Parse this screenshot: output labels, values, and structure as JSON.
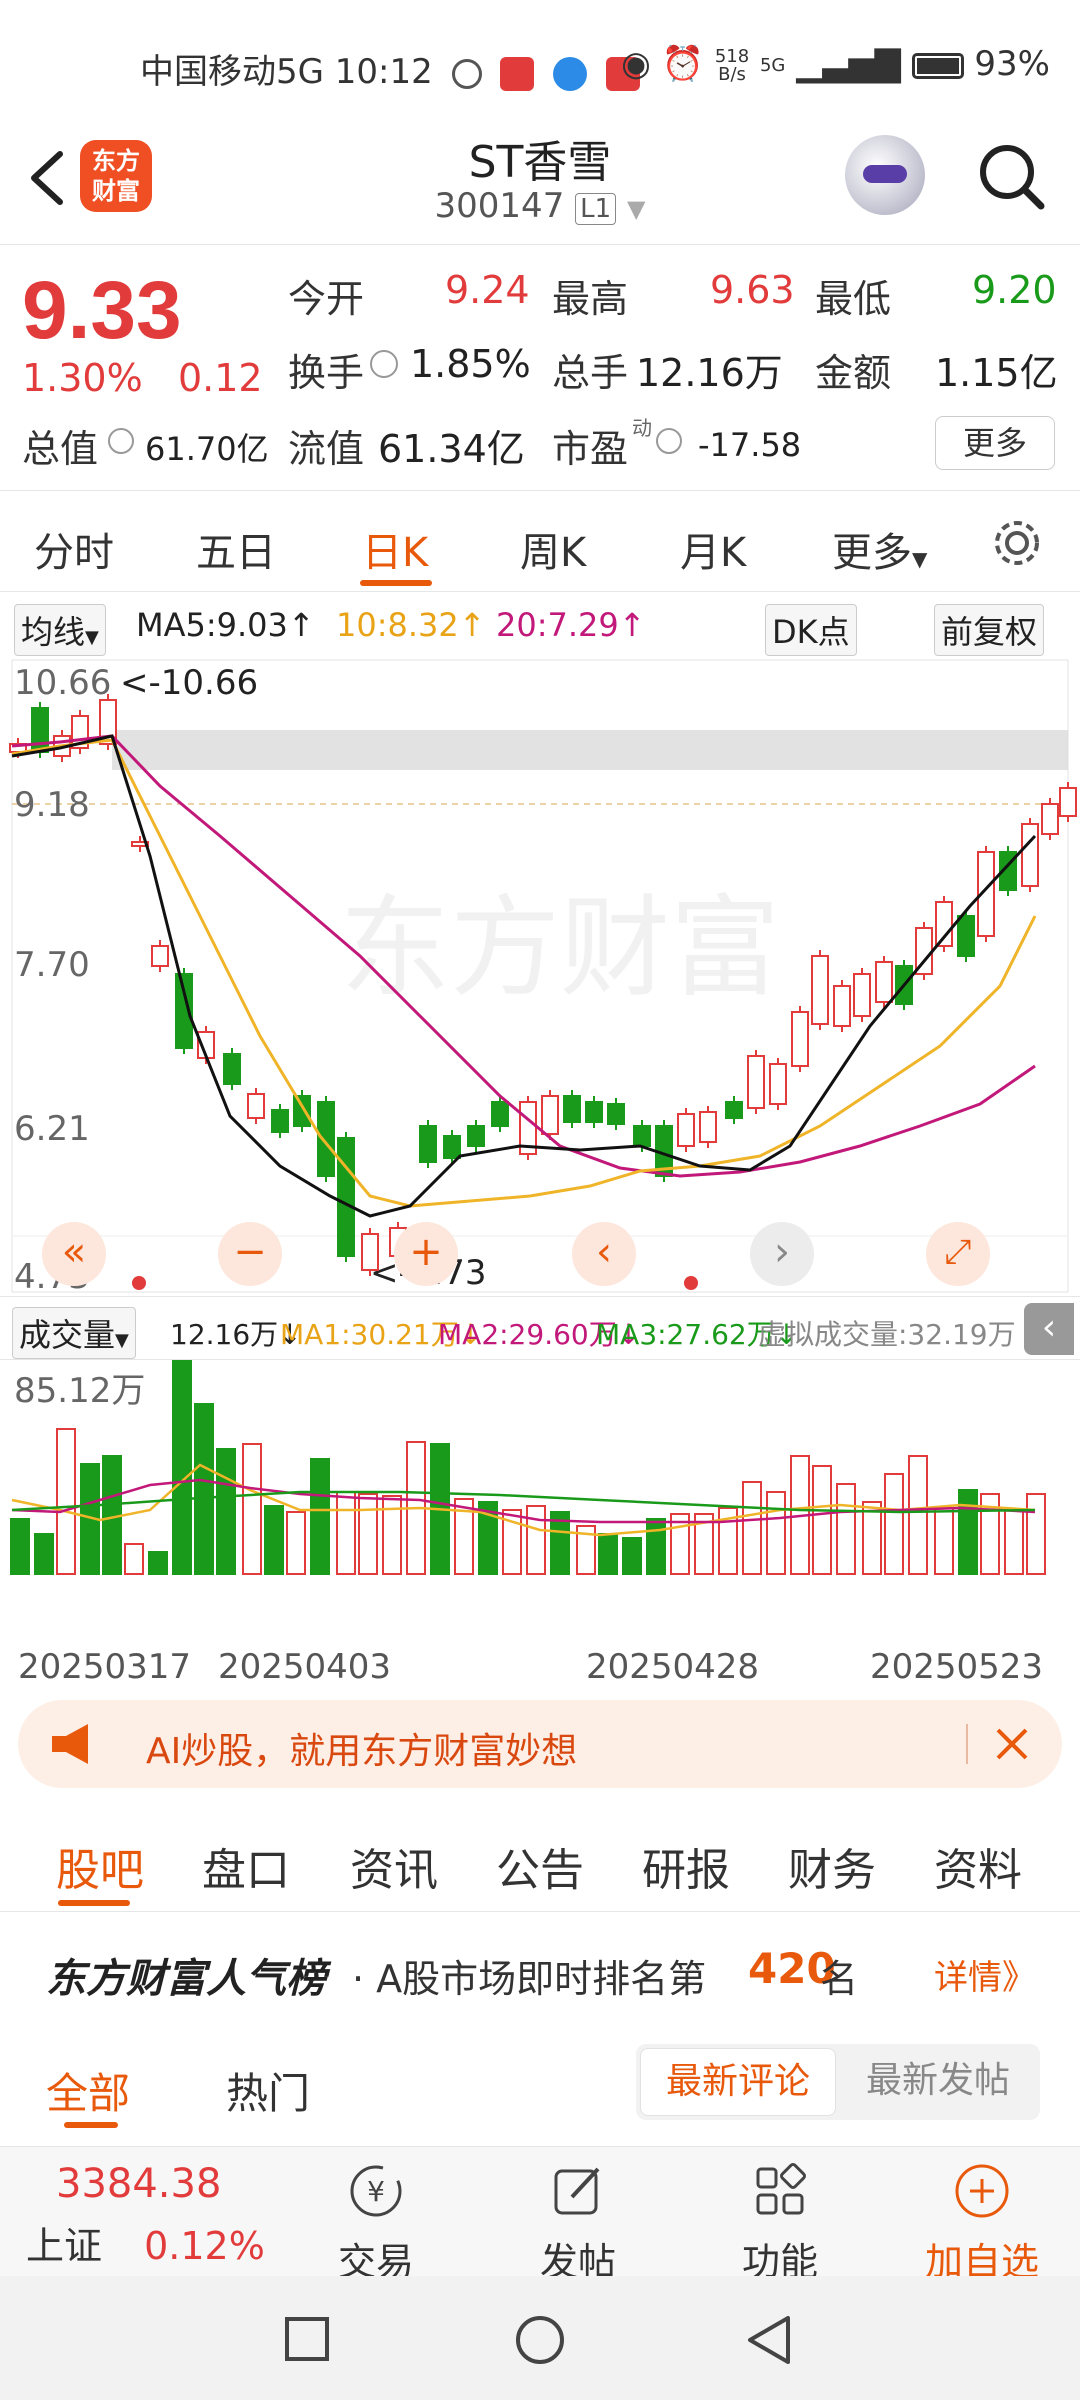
{
  "status": {
    "carrier": "中国移动5G",
    "time": "10:12",
    "net_speed_value": "518",
    "net_speed_unit": "B/s",
    "signal_label": "5G",
    "battery": "93%"
  },
  "header": {
    "logo_line1": "东方",
    "logo_line2": "财富",
    "stock_name": "ST香雪",
    "stock_code": "300147",
    "level_badge": "L1"
  },
  "quote": {
    "price": "9.33",
    "pct_change": "1.30%",
    "change": "0.12",
    "open_label": "今开",
    "open": "9.24",
    "high_label": "最高",
    "high": "9.63",
    "low_label": "最低",
    "low": "9.20",
    "turnover_label": "换手",
    "turnover": "1.85%",
    "volume_label": "总手",
    "volume": "12.16万",
    "amount_label": "金额",
    "amount": "1.15亿",
    "mktcap_label": "总值",
    "mktcap": "61.70亿",
    "float_label": "流值",
    "float": "61.34亿",
    "pe_label": "市盈",
    "pe_sup": "动",
    "pe": "-17.58",
    "more_label": "更多"
  },
  "period_tabs": [
    "分时",
    "五日",
    "日K",
    "周K",
    "月K",
    "更多"
  ],
  "ma_row": {
    "ma_toggle": "均线",
    "ma5": "MA5:9.03↑",
    "ma10": "10:8.32↑",
    "ma20": "20:7.29↑",
    "dk_label": "DK点",
    "adjust_label": "前复权"
  },
  "kline": {
    "y_labels": [
      "10.66",
      "9.18",
      "7.70",
      "6.21",
      "4.73"
    ],
    "max_marker": "<-10.66",
    "min_marker": "<-4.73",
    "watermark": "东方财富"
  },
  "volume_row": {
    "selector": "成交量",
    "total": "12.16万↓",
    "ma1": "MA1:30.21万↓",
    "ma2": "MA2:29.60万↓",
    "ma3": "MA3:27.62万↓",
    "virtual": "虚拟成交量:32.19万",
    "y_max": "85.12万",
    "dates": [
      "20250317",
      "20250403",
      "20250428",
      "20250523"
    ]
  },
  "chart_data": {
    "type": "candlestick",
    "ylim": [
      4.73,
      10.66
    ],
    "ma_series": [
      {
        "name": "MA5",
        "color": "#111111"
      },
      {
        "name": "MA10",
        "color": "#f0b429"
      },
      {
        "name": "MA20",
        "color": "#c2187a"
      }
    ]
  },
  "banner": {
    "text": "AI炒股，就用东方财富妙想"
  },
  "content_tabs": [
    "股吧",
    "盘口",
    "资讯",
    "公告",
    "研报",
    "财务",
    "资料"
  ],
  "rank": {
    "brand": "东方财富人气榜",
    "text_prefix": "· A股市场即时排名第",
    "rank": "420",
    "text_suffix": "名",
    "detail": "详情》"
  },
  "feed_tabs": {
    "all": "全部",
    "hot": "热门",
    "latest_comment": "最新评论",
    "latest_post": "最新发帖"
  },
  "bottom_bar": {
    "index_value": "3384.38",
    "index_name": "上证",
    "index_pct": "0.12%",
    "trade": "交易",
    "post": "发帖",
    "function": "功能",
    "add_watch": "加自选"
  },
  "colors": {
    "up": "#e23b3b",
    "down": "#1a9a1a",
    "accent": "#e8590c"
  }
}
